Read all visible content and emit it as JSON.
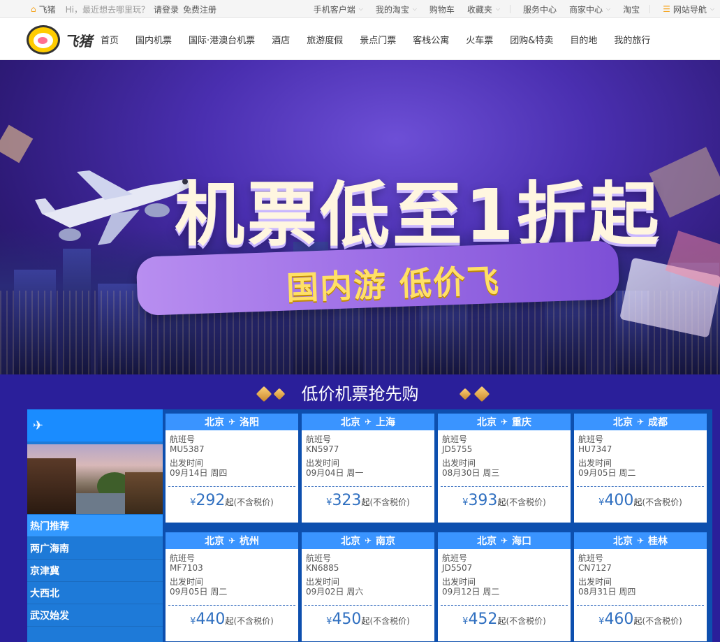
{
  "topbar": {
    "site_name": "飞猪",
    "greeting": "Hi，最近想去哪里玩？",
    "login": "请登录",
    "register": "免费注册",
    "right_items": [
      {
        "label": "手机客户端",
        "dropdown": true
      },
      {
        "label": "我的淘宝",
        "dropdown": true
      },
      {
        "label": "购物车",
        "dropdown": false
      },
      {
        "label": "收藏夹",
        "dropdown": true
      },
      {
        "label": "服务中心",
        "dropdown": false
      },
      {
        "label": "商家中心",
        "dropdown": true
      },
      {
        "label": "淘宝",
        "dropdown": false
      },
      {
        "label": "网站导航",
        "dropdown": true
      }
    ]
  },
  "logo": {
    "name": "飞猪"
  },
  "nav": {
    "items": [
      "首页",
      "国内机票",
      "国际·港澳台机票",
      "酒店",
      "旅游度假",
      "景点门票",
      "客栈公寓",
      "火车票",
      "团购&特卖",
      "目的地",
      "我的旅行"
    ]
  },
  "hero": {
    "headline": "机票低至1折起",
    "subline": "国内游 低价飞"
  },
  "deals": {
    "title": "低价机票抢先购",
    "sidebar": {
      "icon": "plane-icon",
      "items": [
        {
          "label": "热门推荐",
          "active": true
        },
        {
          "label": "两广海南",
          "active": false
        },
        {
          "label": "京津冀",
          "active": false
        },
        {
          "label": "大西北",
          "active": false
        },
        {
          "label": "武汉始发",
          "active": false
        }
      ]
    },
    "labels": {
      "flight_no": "航班号",
      "departure": "出发时间",
      "currency": "¥",
      "price_suffix": "起",
      "tax_note": "(不含税价)"
    },
    "cards": [
      {
        "from": "北京",
        "to": "洛阳",
        "flight": "MU5387",
        "date": "09月14日 周四",
        "price": "292"
      },
      {
        "from": "北京",
        "to": "上海",
        "flight": "KN5977",
        "date": "09月04日 周一",
        "price": "323"
      },
      {
        "from": "北京",
        "to": "重庆",
        "flight": "JD5755",
        "date": "08月30日 周三",
        "price": "393"
      },
      {
        "from": "北京",
        "to": "成都",
        "flight": "HU7347",
        "date": "09月05日 周二",
        "price": "400"
      },
      {
        "from": "北京",
        "to": "杭州",
        "flight": "MF7103",
        "date": "09月05日 周二",
        "price": "440"
      },
      {
        "from": "北京",
        "to": "南京",
        "flight": "KN6885",
        "date": "09月02日 周六",
        "price": "450"
      },
      {
        "from": "北京",
        "to": "海口",
        "flight": "JD5507",
        "date": "09月12日 周二",
        "price": "452"
      },
      {
        "from": "北京",
        "to": "桂林",
        "flight": "CN7127",
        "date": "08月31日 周四",
        "price": "460"
      }
    ]
  },
  "colors": {
    "accent": "#f5a623",
    "deal_bg": "#2a1f9a",
    "card_header": "#3a94ff",
    "price": "#2f6fc0"
  }
}
